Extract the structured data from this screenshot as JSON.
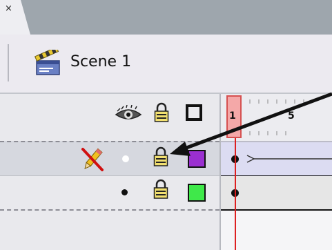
{
  "tab": {
    "close_glyph": "×"
  },
  "scene": {
    "label": "Scene 1",
    "icon": "clapperboard-icon"
  },
  "layer_header": {
    "icons": [
      "eye-icon",
      "lock-icon",
      "outline-square-icon"
    ]
  },
  "layers": [
    {
      "selected": true,
      "status_icon": "pencil-crossed-icon",
      "visibility": "white-dot",
      "locked": true,
      "outline_color": "#9a2fd0"
    },
    {
      "selected": false,
      "status_icon": "",
      "visibility": "black-dot",
      "locked": true,
      "outline_color": "#3fe84a"
    }
  ],
  "timeline": {
    "current_frame": "1",
    "frame_labels": [
      "1",
      "5"
    ]
  },
  "colors": {
    "playhead": "#dd2020",
    "selected_row": "#d6d8df",
    "frame_fill": "#dcdcf2"
  }
}
